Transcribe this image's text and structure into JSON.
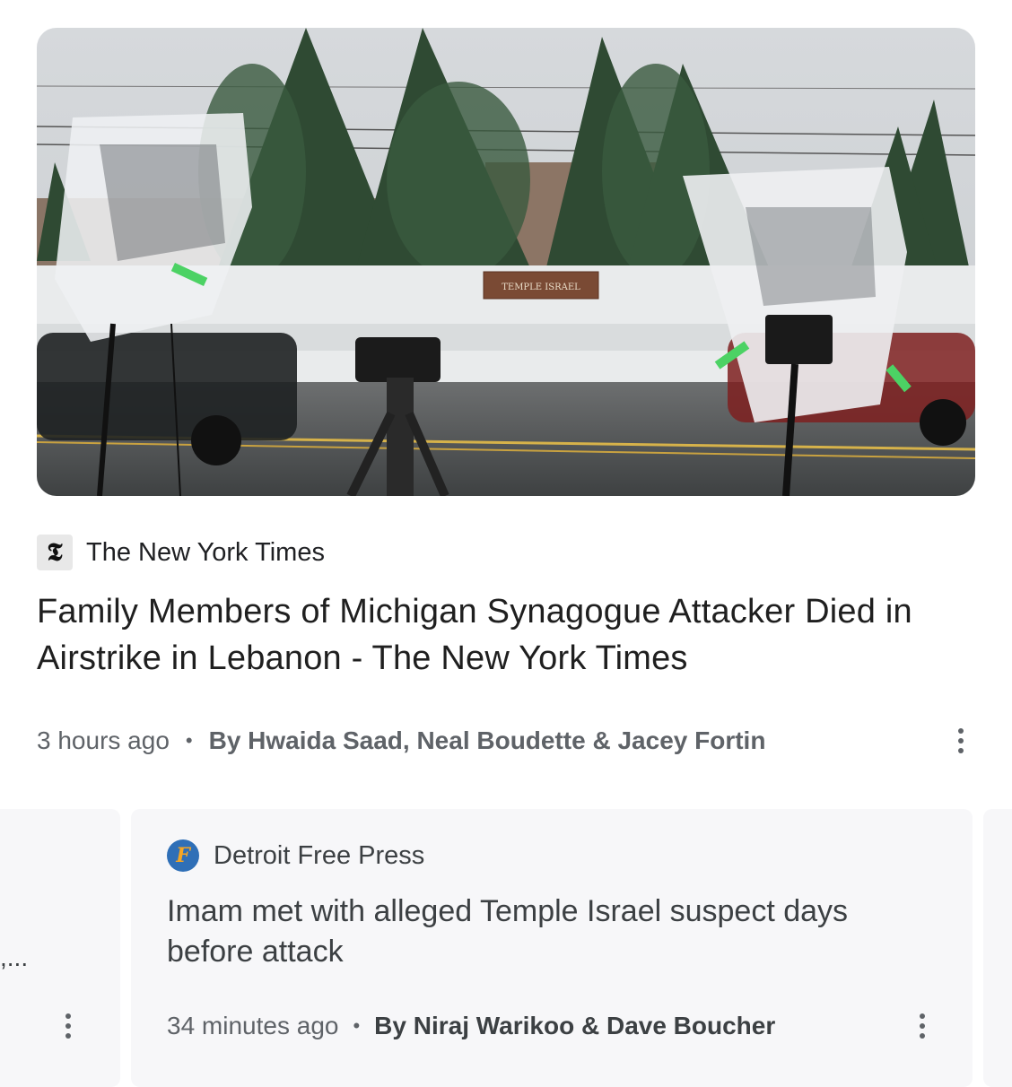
{
  "top_story": {
    "image_alt": "Covered news cameras across the street from the Temple Israel sign in the snow",
    "sign_text": "TEMPLE ISRAEL",
    "publisher": {
      "name": "The New York Times",
      "logo": "𝕿"
    },
    "headline": "Family Members of Michigan Synagogue Attacker Died in Airstrike in Lebanon - The New York Times",
    "time": "3 hours ago",
    "separator": "•",
    "byline": "By Hwaida Saad, Neal Boudette & Jacey Fortin",
    "menu_icon": "more-vert-icon"
  },
  "carousel": {
    "left_card": {
      "truncated_text": ",..."
    },
    "main_card": {
      "publisher": {
        "name": "Detroit Free Press",
        "logo": "F"
      },
      "title": "Imam met with alleged Temple Israel suspect days before attack",
      "time": "34 minutes ago",
      "separator": "•",
      "byline": "By Niraj Warikoo & Dave Boucher"
    }
  },
  "colors": {
    "card_bg": "#f7f7f9",
    "meta_gray": "#5f6368",
    "text_dark": "#1f1f1f"
  }
}
